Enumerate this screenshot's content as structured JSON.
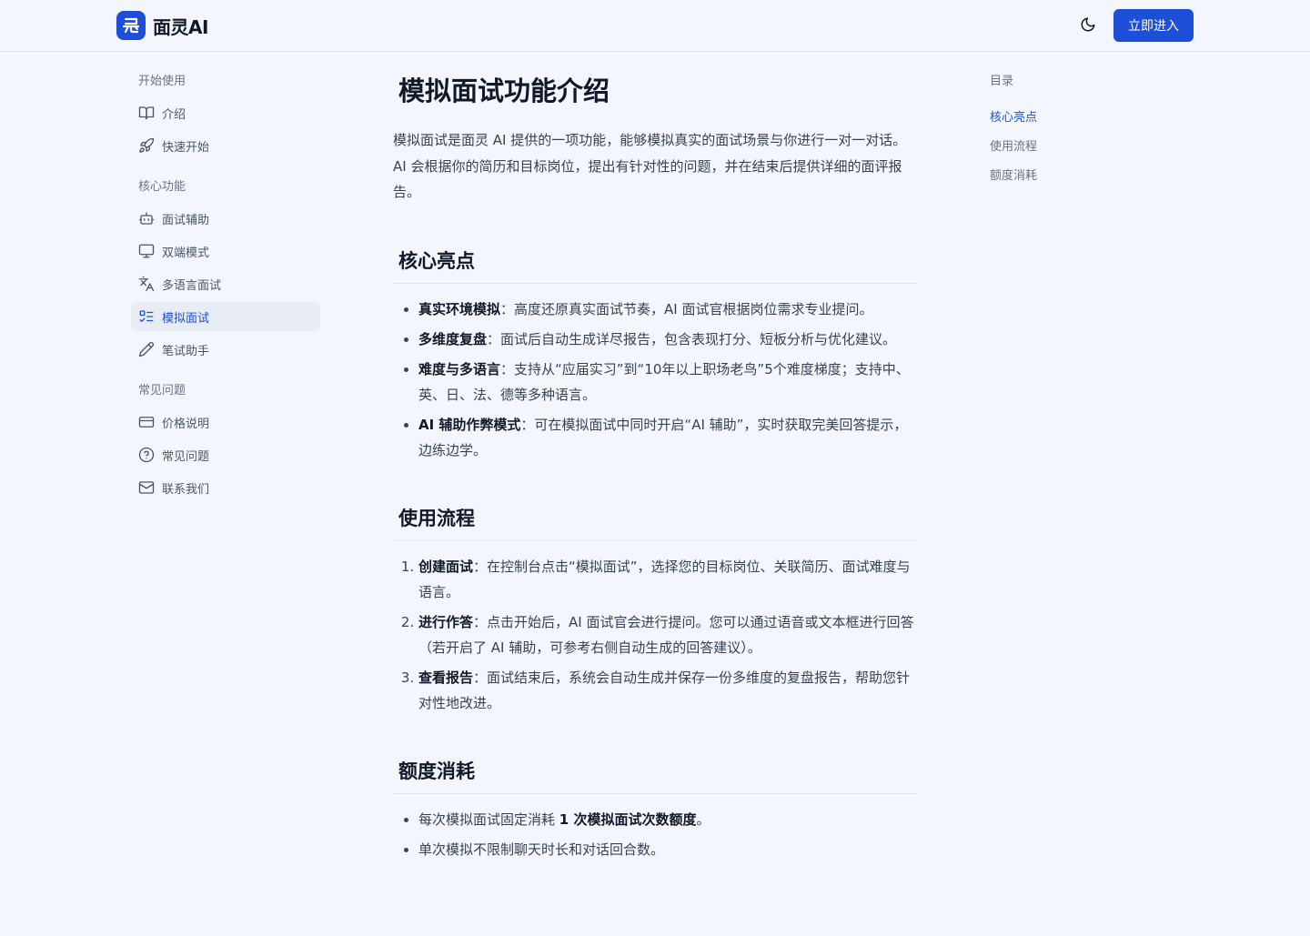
{
  "header": {
    "brand": "面灵AI",
    "enter_label": "立即进入"
  },
  "sidebar": {
    "groups": [
      {
        "title": "开始使用",
        "items": [
          {
            "label": "介绍",
            "icon": "book-open-icon"
          },
          {
            "label": "快速开始",
            "icon": "rocket-icon"
          }
        ]
      },
      {
        "title": "核心功能",
        "items": [
          {
            "label": "面试辅助",
            "icon": "robot-icon"
          },
          {
            "label": "双端模式",
            "icon": "monitor-icon"
          },
          {
            "label": "多语言面试",
            "icon": "translate-icon"
          },
          {
            "label": "模拟面试",
            "icon": "list-checks-icon",
            "active": true
          },
          {
            "label": "笔试助手",
            "icon": "pencil-icon"
          }
        ]
      },
      {
        "title": "常见问题",
        "items": [
          {
            "label": "价格说明",
            "icon": "credit-card-icon"
          },
          {
            "label": "常见问题",
            "icon": "help-circle-icon"
          },
          {
            "label": "联系我们",
            "icon": "mail-icon"
          }
        ]
      }
    ]
  },
  "main": {
    "title": "模拟面试功能介绍",
    "intro": "模拟面试是面灵 AI 提供的一项功能，能够模拟真实的面试场景与你进行一对一对话。AI 会根据你的简历和目标岗位，提出有针对性的问题，并在结束后提供详细的面评报告。",
    "highlights": {
      "title": "核心亮点",
      "items": [
        {
          "bold": "真实环境模拟",
          "text": "：高度还原真实面试节奏，AI 面试官根据岗位需求专业提问。"
        },
        {
          "bold": "多维度复盘",
          "text": "：面试后自动生成详尽报告，包含表现打分、短板分析与优化建议。"
        },
        {
          "bold": "难度与多语言",
          "text": "：支持从“应届实习”到“10年以上职场老鸟”5个难度梯度；支持中、英、日、法、德等多种语言。"
        },
        {
          "bold": "AI 辅助作弊模式",
          "text": "：可在模拟面试中同时开启“AI 辅助”，实时获取完美回答提示，边练边学。"
        }
      ]
    },
    "flow": {
      "title": "使用流程",
      "items": [
        {
          "bold": "创建面试",
          "text": "：在控制台点击“模拟面试”，选择您的目标岗位、关联简历、面试难度与语言。"
        },
        {
          "bold": "进行作答",
          "text": "：点击开始后，AI 面试官会进行提问。您可以通过语音或文本框进行回答（若开启了 AI 辅助，可参考右侧自动生成的回答建议）。"
        },
        {
          "bold": "查看报告",
          "text": "：面试结束后，系统会自动生成并保存一份多维度的复盘报告，帮助您针对性地改进。"
        }
      ]
    },
    "quota": {
      "title": "额度消耗",
      "item1_before": "每次模拟面试固定消耗 ",
      "item1_bold": "1 次模拟面试次数额度",
      "item1_after": "。",
      "item2": "单次模拟不限制聊天时长和对话回合数。"
    }
  },
  "toc": {
    "title": "目录",
    "items": [
      "核心亮点",
      "使用流程",
      "额度消耗"
    ]
  },
  "colors": {
    "accent": "#1d4ed8",
    "background": "#f3f7fd",
    "active_bg": "#e8edf5"
  }
}
